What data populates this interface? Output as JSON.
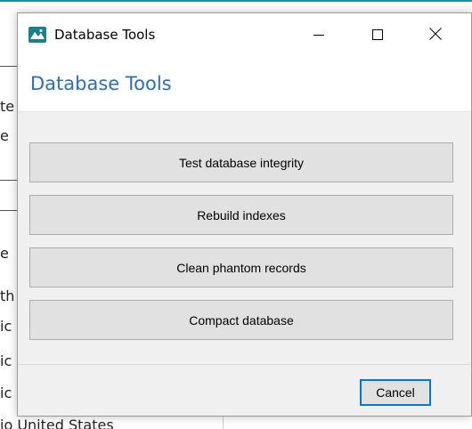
{
  "window": {
    "title": "Database Tools",
    "icon": "database-tools-app-icon"
  },
  "window_controls": {
    "minimize_icon": "minimize-icon",
    "maximize_icon": "maximize-icon",
    "close_icon": "close-icon"
  },
  "header": {
    "title": "Database Tools",
    "title_color": "#2b6cc4"
  },
  "tools": [
    {
      "label": "Test database integrity"
    },
    {
      "label": "Rebuild indexes"
    },
    {
      "label": "Clean phantom records"
    },
    {
      "label": "Compact database"
    }
  ],
  "footer": {
    "cancel_label": "Cancel",
    "focus_color": "#0078d7"
  },
  "background": {
    "side_chars": [
      "te",
      "e",
      "e",
      "th",
      "ic",
      "ic",
      "ic"
    ],
    "bottom_text": "io  United States"
  }
}
